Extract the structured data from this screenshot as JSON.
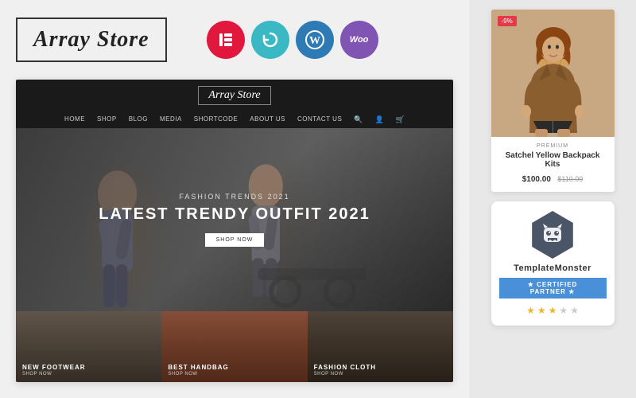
{
  "header": {
    "logo_text": "Array Store",
    "plugins": [
      {
        "name": "elementor",
        "label": "E",
        "color": "#e2173e"
      },
      {
        "name": "revolution-slider",
        "label": "↺",
        "color": "#3ab8c3"
      },
      {
        "name": "wordpress",
        "label": "W",
        "color": "#2d7ab5"
      },
      {
        "name": "woocommerce",
        "label": "Woo",
        "color": "#7f54b3"
      }
    ]
  },
  "store": {
    "nav_logo": "Array Store",
    "menu_items": [
      "HOME",
      "SHOP",
      "BLOG",
      "MEDIA",
      "SHORTCODE",
      "ABOUT US",
      "CONTACT US"
    ],
    "hero": {
      "subtitle": "Fashion Trends 2021",
      "title": "LATEST TRENDY OUTFIT 2021",
      "button": "SHOP NOW"
    },
    "categories": [
      {
        "label": "NEW FOOTWEAR",
        "sub": "SHOP NOW"
      },
      {
        "label": "BEST HANDBAG",
        "sub": "SHOP NOW"
      },
      {
        "label": "FASHION CLOTH",
        "sub": "SHOP NOW"
      }
    ]
  },
  "product_card": {
    "badge": "-9%",
    "category": "PREMIUM",
    "name": "Satchel Yellow Backpack Kits",
    "price": "$100.00",
    "original_price": "$110.00"
  },
  "template_monster": {
    "brand": "TemplateMonster",
    "certified_label": "★ CERTIFIED PARTNER ★",
    "stars_filled": 3,
    "stars_empty": 2
  }
}
